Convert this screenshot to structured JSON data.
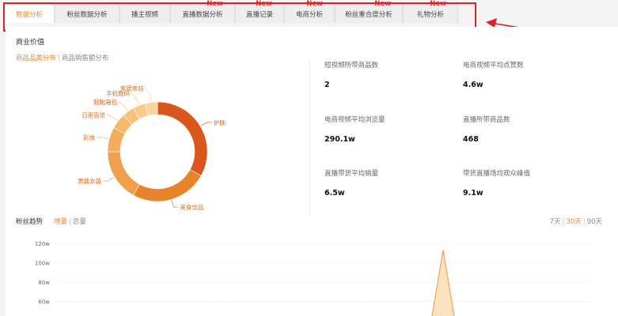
{
  "tabs": [
    {
      "label": "数据分析",
      "new": "",
      "active": true
    },
    {
      "label": "粉丝数据分析",
      "new": ""
    },
    {
      "label": "播主视频",
      "new": ""
    },
    {
      "label": "直播数据分析",
      "new": "New"
    },
    {
      "label": "直播记录",
      "new": "New"
    },
    {
      "label": "电商分析",
      "new": "New"
    },
    {
      "label": "粉丝重合度分析",
      "new": "New"
    },
    {
      "label": "礼物分析",
      "new": "New"
    }
  ],
  "commerce": {
    "title": "商业价值",
    "subtabs": [
      "商品品类分布",
      "商品销售额分布"
    ]
  },
  "stats": [
    {
      "label": "短视频所带商品数",
      "value": "2"
    },
    {
      "label": "电商视频平均点赞数",
      "value": "4.6w"
    },
    {
      "label": "电商视频平均浏览量",
      "value": "290.1w"
    },
    {
      "label": "直播所带商品数",
      "value": "468"
    },
    {
      "label": "直播带货平均销量",
      "value": "6.5w"
    },
    {
      "label": "带货直播场均观众峰值",
      "value": "9.1w"
    }
  ],
  "fans_trend": {
    "title": "粉丝趋势",
    "modes": [
      "增量",
      "总量"
    ],
    "ranges": [
      "7天",
      "30天",
      "90天"
    ]
  },
  "chart_data": [
    {
      "type": "pie",
      "title": "商品品类分布",
      "labels": [
        "护肤",
        "美食饮品",
        "男装女装",
        "彩妆",
        "日用百货",
        "鞋靴箱包",
        "手机数码",
        "家居家纺"
      ],
      "values": [
        33,
        25,
        17,
        8,
        5,
        4,
        4,
        4
      ],
      "colors": [
        "#d9571c",
        "#e8832c",
        "#f0a04b",
        "#f4ad5c",
        "#f6b86a",
        "#f8c27b",
        "#f9cb8b",
        "#fbd59d"
      ]
    },
    {
      "type": "area",
      "title": "",
      "y_ticks": [
        "120w",
        "100w",
        "80w",
        "60w"
      ],
      "ylim": [
        50,
        120
      ],
      "note": "",
      "peak_value": 113
    }
  ]
}
